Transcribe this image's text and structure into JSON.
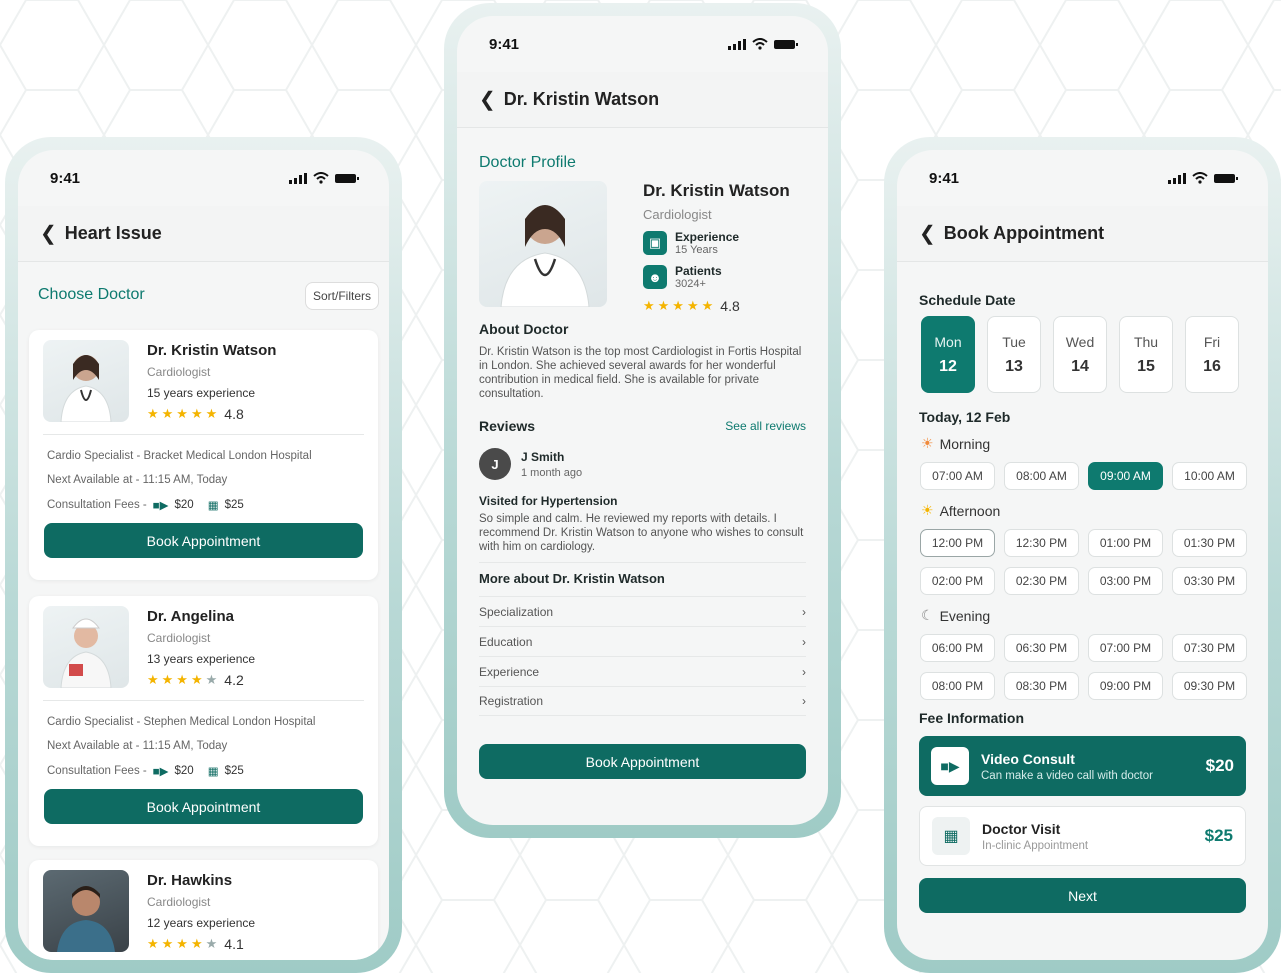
{
  "status_time": "9:41",
  "phone1": {
    "nav_title": "Heart Issue",
    "section": "Choose Doctor",
    "filter": "Sort/Filters",
    "book": "Book Appointment",
    "doctors": [
      {
        "name": "Dr. Kristin Watson",
        "spec": "Cardiologist",
        "exp": "15 years experience",
        "rating": "4.8",
        "stars": 5,
        "hospital": "Cardio Specialist - Bracket Medical London Hospital",
        "next": "Next Available at - 11:15 AM, Today",
        "fees_label": "Consultation Fees -",
        "fee_video": "$20",
        "fee_visit": "$25"
      },
      {
        "name": "Dr. Angelina",
        "spec": "Cardiologist",
        "exp": "13 years experience",
        "rating": "4.2",
        "stars": 4,
        "hospital": "Cardio Specialist - Stephen Medical London Hospital",
        "next": "Next Available at - 11:15 AM, Today",
        "fees_label": "Consultation Fees -",
        "fee_video": "$20",
        "fee_visit": "$25"
      },
      {
        "name": "Dr. Hawkins",
        "spec": "Cardiologist",
        "exp": "12 years experience",
        "rating": "4.1",
        "stars": 4
      }
    ]
  },
  "phone2": {
    "nav_title": "Dr. Kristin Watson",
    "section": "Doctor Profile",
    "name": "Dr. Kristin Watson",
    "spec": "Cardiologist",
    "exp_label": "Experience",
    "exp_val": "15 Years",
    "pat_label": "Patients",
    "pat_val": "3024+",
    "rating": "4.8",
    "about_title": "About Doctor",
    "about_text": "Dr. Kristin Watson is the top most Cardiologist in Fortis Hospital in London. She achieved several awards for her wonderful contribution in medical field. She is available for private consultation.",
    "reviews_title": "Reviews",
    "see_all": "See all reviews",
    "reviewer_initial": "J",
    "reviewer": "J Smith",
    "review_time": "1 month ago",
    "review_title": "Visited for Hypertension",
    "review_text": "So simple and calm. He reviewed my reports with details. I recommend Dr. Kristin Watson to anyone who wishes to consult with him on cardiology.",
    "more_title": "More about Dr. Kristin Watson",
    "more_items": [
      "Specialization",
      "Education",
      "Experience",
      "Registration"
    ],
    "book": "Book Appointment"
  },
  "phone3": {
    "nav_title": "Book Appointment",
    "schedule": "Schedule Date",
    "days": [
      {
        "d": "Mon",
        "n": "12"
      },
      {
        "d": "Tue",
        "n": "13"
      },
      {
        "d": "Wed",
        "n": "14"
      },
      {
        "d": "Thu",
        "n": "15"
      },
      {
        "d": "Fri",
        "n": "16"
      }
    ],
    "today": "Today, 12 Feb",
    "morning": "Morning",
    "morning_slots": [
      "07:00 AM",
      "08:00 AM",
      "09:00 AM",
      "10:00 AM"
    ],
    "afternoon": "Afternoon",
    "afternoon_slots": [
      "12:00 PM",
      "12:30 PM",
      "01:00 PM",
      "01:30 PM",
      "02:00 PM",
      "02:30 PM",
      "03:00 PM",
      "03:30 PM"
    ],
    "evening": "Evening",
    "evening_slots": [
      "06:00 PM",
      "06:30 PM",
      "07:00 PM",
      "07:30 PM",
      "08:00 PM",
      "08:30 PM",
      "09:00 PM",
      "09:30 PM"
    ],
    "fee_title": "Fee Information",
    "video_title": "Video Consult",
    "video_sub": "Can make a video call with doctor",
    "video_price": "$20",
    "visit_title": "Doctor Visit",
    "visit_sub": "In-clinic Appointment",
    "visit_price": "$25",
    "next": "Next"
  },
  "colors": {
    "accent": "#0e7a6f",
    "button": "#0e6b62",
    "star": "#f4b400"
  }
}
